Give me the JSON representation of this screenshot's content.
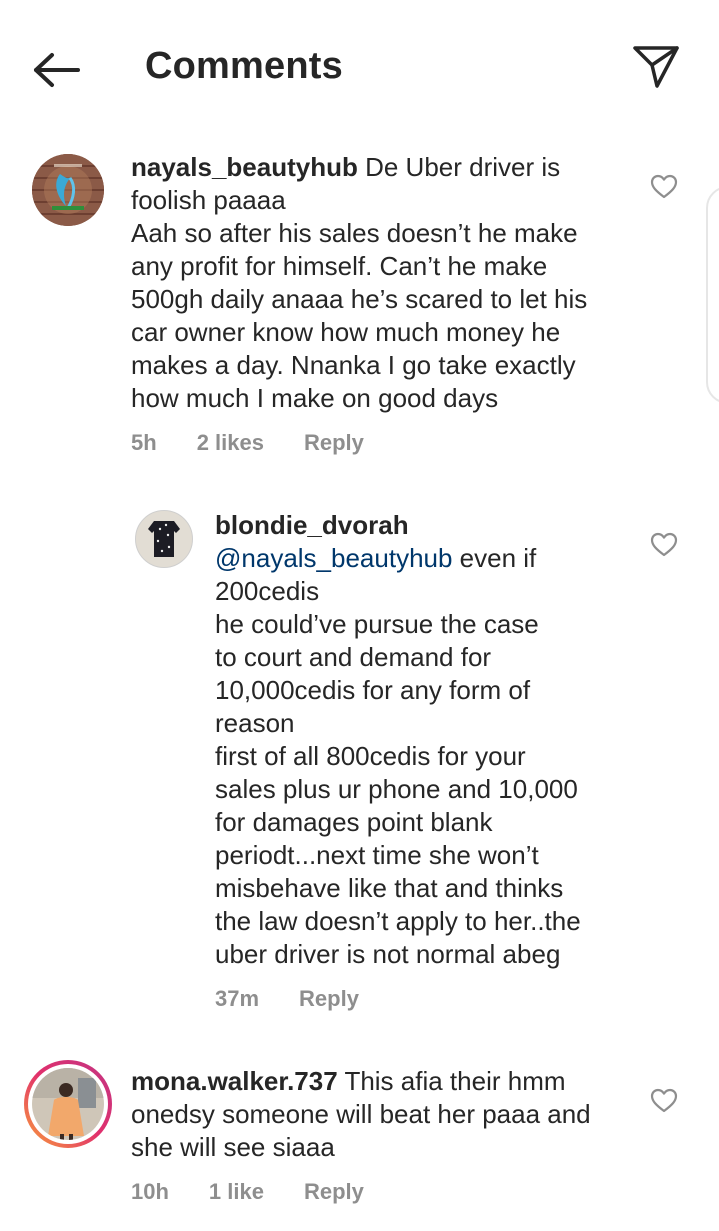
{
  "header": {
    "title": "Comments"
  },
  "comments": [
    {
      "username": "nayals_beautyhub",
      "first_line_text": " De Uber driver is",
      "text_lines": [
        "foolish paaaa",
        "Aah so after his sales doesn’t he make",
        "any profit for himself. Can’t he make",
        "500gh daily anaaa he’s scared to let his",
        "car owner know how much money he",
        "makes a day. Nnanka I go take exactly",
        "how much I make on good days"
      ],
      "time": "5h",
      "likes": "2 likes",
      "reply": "Reply"
    },
    {
      "username": "blondie_dvorah",
      "mention": "@nayals_beautyhub",
      "mention_tail": " even if",
      "text_lines": [
        "200cedis",
        "he could’ve pursue the case",
        "to court and demand for",
        "10,000cedis for any form of",
        "reason",
        "first of all 800cedis for your",
        "sales plus ur phone and 10,000",
        "for damages point blank",
        "periodt...next time she won’t",
        "misbehave like that and thinks",
        "the law doesn’t apply to her..the",
        "uber driver is not normal abeg"
      ],
      "time": "37m",
      "reply": "Reply"
    },
    {
      "username": "mona.walker.737",
      "first_line_text": " This afia their hmm",
      "text_lines": [
        "onedsy someone will beat her paaa and",
        "she will see siaaa"
      ],
      "time": "10h",
      "likes": "1 like",
      "reply": "Reply"
    }
  ]
}
